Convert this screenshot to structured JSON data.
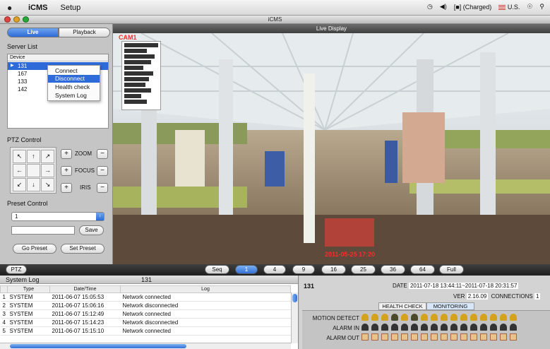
{
  "menubar": {
    "app": "iCMS",
    "menus": [
      "Setup"
    ],
    "battery": "(Charged)",
    "locale": "U.S."
  },
  "window": {
    "title": "iCMS"
  },
  "left": {
    "tabs": [
      {
        "label": "Live",
        "active": true
      },
      {
        "label": "Playback",
        "active": false
      }
    ],
    "server_list_title": "Server List",
    "device_header": "Device",
    "devices": [
      "131",
      "167",
      "133",
      "142"
    ],
    "context_menu": [
      "Connect",
      "Disconnect",
      "Health check",
      "System Log"
    ],
    "ptz_title": "PTZ Control",
    "ptz_arrows": [
      "↖",
      "↑",
      "↗",
      "←",
      "",
      "→",
      "↙",
      "↓",
      "↘"
    ],
    "zoom_label": "ZOOM",
    "focus_label": "FOCUS",
    "iris_label": "IRIS",
    "plus": "+",
    "minus": "−",
    "preset_title": "Preset Control",
    "preset_value": "1",
    "save_label": "Save",
    "go_preset": "Go Preset",
    "set_preset": "Set Preset"
  },
  "video": {
    "title": "Live Display",
    "cam_label": "CAM1",
    "timestamp": "2011-05-25 17:20"
  },
  "bottombar": {
    "ptz": "PTZ",
    "layouts": [
      "Seq",
      "1",
      "4",
      "9",
      "16",
      "25",
      "36",
      "64",
      "Full"
    ],
    "active": "1"
  },
  "syslog": {
    "title": "System Log",
    "server": "131",
    "columns": [
      "",
      "Type",
      "Date/Time",
      "Log"
    ],
    "rows": [
      [
        "1",
        "SYSTEM",
        "2011-06-07 15:05:53",
        "Network connected"
      ],
      [
        "2",
        "SYSTEM",
        "2011-06-07 15:06:16",
        "Network disconnected"
      ],
      [
        "3",
        "SYSTEM",
        "2011-06-07 15:12:49",
        "Network connected"
      ],
      [
        "4",
        "SYSTEM",
        "2011-06-07 15:14:23",
        "Network disconnected"
      ],
      [
        "5",
        "SYSTEM",
        "2011-06-07 15:15:10",
        "Network connected"
      ]
    ]
  },
  "status": {
    "server": "131",
    "date_label": "DATE",
    "date_value": "2011-07-18 13:44:11~2011-07-18 20:31:57",
    "ver_label": "VER",
    "ver_value": "2.16.09",
    "conn_label": "CONNECTIONS",
    "conn_value": "1",
    "tabs": [
      "HEALTH CHECK",
      "MONITORING"
    ],
    "rows": [
      "MOTION DETECT",
      "ALARM IN",
      "ALARM OUT"
    ]
  },
  "colors": {
    "selection": "#2f6bd8",
    "video_floor": "#d7cbb0",
    "timestamp": "#ff2a2a"
  }
}
